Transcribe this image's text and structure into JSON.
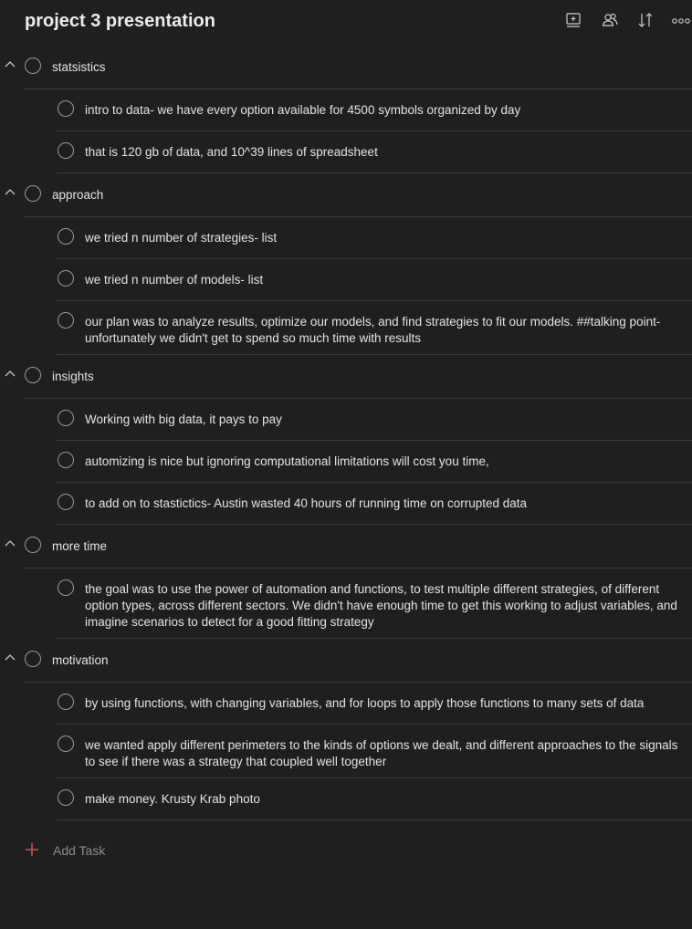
{
  "header": {
    "title": "project 3 presentation",
    "toolbar": [
      {
        "icon": "add-section-icon"
      },
      {
        "icon": "share-people-icon"
      },
      {
        "icon": "sort-icon"
      },
      {
        "icon": "more-icon"
      }
    ]
  },
  "sections": [
    {
      "title": "statsistics",
      "tasks": [
        {
          "text": "intro to data- we have every option available for 4500 symbols organized by day"
        },
        {
          "text": "that is 120 gb of data, and 10^39 lines of spreadsheet"
        }
      ]
    },
    {
      "title": "approach",
      "tasks": [
        {
          "text": "we tried n number of strategies- list"
        },
        {
          "text": "we tried n number of models- list"
        },
        {
          "text": "our plan was to analyze results, optimize our models, and find strategies to fit our models. ##talking point- unfortunately we didn't get to spend so much time with results"
        }
      ]
    },
    {
      "title": "insights",
      "tasks": [
        {
          "text": "Working with big data, it pays to pay"
        },
        {
          "text": "automizing is nice but ignoring computational limitations will cost you time,"
        },
        {
          "text": "to add on to stastictics- Austin wasted 40 hours of running time on corrupted data"
        }
      ]
    },
    {
      "title": "more time",
      "tasks": [
        {
          "text": "the goal was to use the power of automation and functions, to test multiple different strategies, of different option types, across different sectors. We didn't have enough time to get this working to adjust variables, and imagine scenarios to detect for a good fitting strategy"
        }
      ]
    },
    {
      "title": "motivation",
      "tasks": [
        {
          "text": "by using functions, with changing variables, and for loops to apply those functions to many sets of data"
        },
        {
          "text": "we wanted apply different perimeters to the kinds of options we dealt, and different approaches to the signals to see if there was a strategy that coupled well together"
        },
        {
          "text": "make money. Krusty Krab photo"
        }
      ]
    }
  ],
  "add_task": {
    "label": "Add Task",
    "color": "#d9534f"
  }
}
